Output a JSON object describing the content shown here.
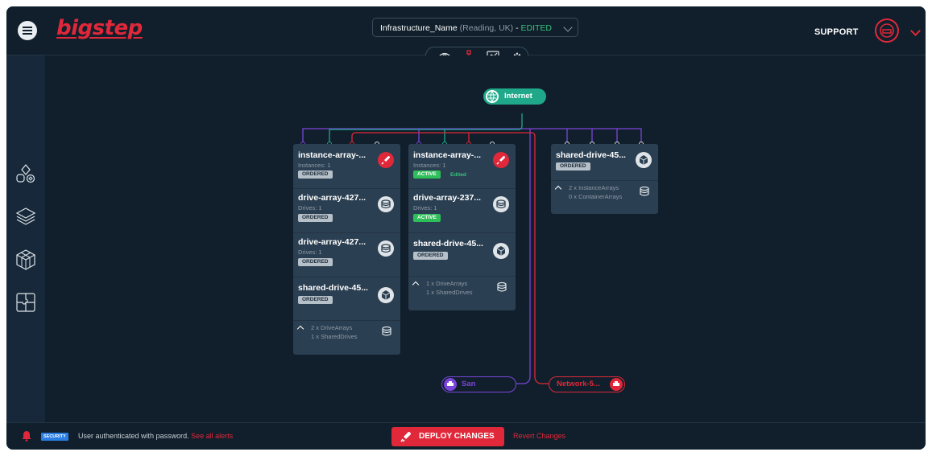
{
  "header": {
    "logo_text": "bigstep",
    "infrastructure": {
      "name": "Infrastructure_Name",
      "location": "(Reading, UK)",
      "separator": " - ",
      "status": "EDITED"
    },
    "support_label": "SUPPORT",
    "view_toggle": [
      "eye-icon",
      "topology-icon",
      "monitor-icon",
      "gear-icon"
    ]
  },
  "sidebar": {
    "items": [
      "shapes-icon",
      "layers-icon",
      "cube-icon",
      "puzzle-icon"
    ]
  },
  "nodes": {
    "internet": "Internet",
    "san": "San",
    "network": "Network-5..."
  },
  "cards": {
    "left": {
      "header": {
        "title": "instance-array-...",
        "sub": "Instances: 1",
        "badge": "ORDERED"
      },
      "rows": [
        {
          "title": "drive-array-427...",
          "sub": "Drives: 1",
          "badge": "ORDERED"
        },
        {
          "title": "drive-array-427...",
          "sub": "Drives: 1",
          "badge": "ORDERED"
        },
        {
          "title": "shared-drive-45...",
          "badge": "ORDERED"
        }
      ],
      "footer": {
        "line1": "2 x DriveArrays",
        "line2": "1 x SharedDrives"
      }
    },
    "middle": {
      "header": {
        "title": "instance-array-...",
        "sub": "Instances: 1",
        "badge": "ACTIVE",
        "note": "Edited"
      },
      "rows": [
        {
          "title": "drive-array-237...",
          "sub": "Drives: 1",
          "badge": "ACTIVE"
        },
        {
          "title": "shared-drive-45...",
          "badge": "ORDERED"
        }
      ],
      "footer": {
        "line1": "1 x DriveArrays",
        "line2": "1 x SharedDrives"
      }
    },
    "right": {
      "header": {
        "title": "shared-drive-45...",
        "badge": "ORDERED"
      },
      "footer": {
        "line1": "2 x InstanceArrays",
        "line2": "0 x ContainerArrays"
      }
    }
  },
  "footer": {
    "security_badge": "SECURITY",
    "alert_text": "User authenticated with password. ",
    "alert_link": "See all alerts",
    "deploy_label": "DEPLOY CHANGES",
    "revert_label": "Revert Changes"
  },
  "colors": {
    "accent": "#e0283a",
    "internet": "#1fa98a",
    "san": "#7b45d9",
    "active": "#2fbf5a",
    "background": "#101f2b",
    "card": "#2b3f52"
  }
}
